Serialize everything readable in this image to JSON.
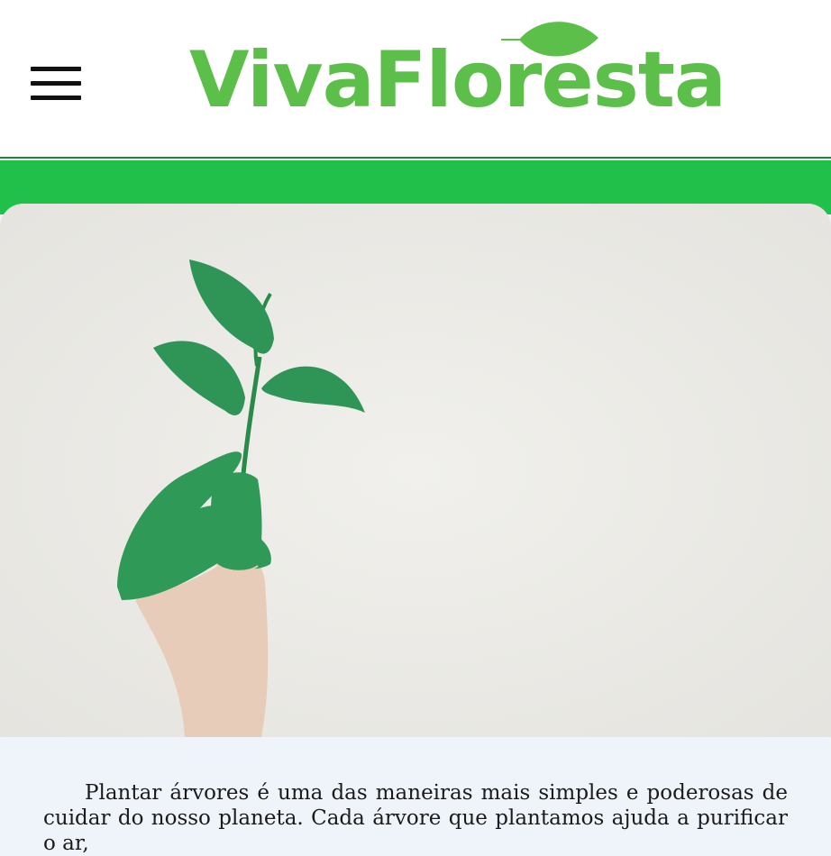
{
  "header": {
    "logo_text": "VivaFloresta",
    "menu_icon": "hamburger-menu-icon",
    "logo_icon": "leaf-icon"
  },
  "colors": {
    "brand_green": "#5cbf4a",
    "band_green": "#20c04a",
    "page_background": "#eff4fa"
  },
  "hero": {
    "image": "hand-holding-seedling"
  },
  "article": {
    "paragraph": "Plantar árvores é uma das maneiras mais simples e poderosas de cuidar do nosso planeta. Cada árvore que plantamos ajuda a purificar o ar,"
  }
}
